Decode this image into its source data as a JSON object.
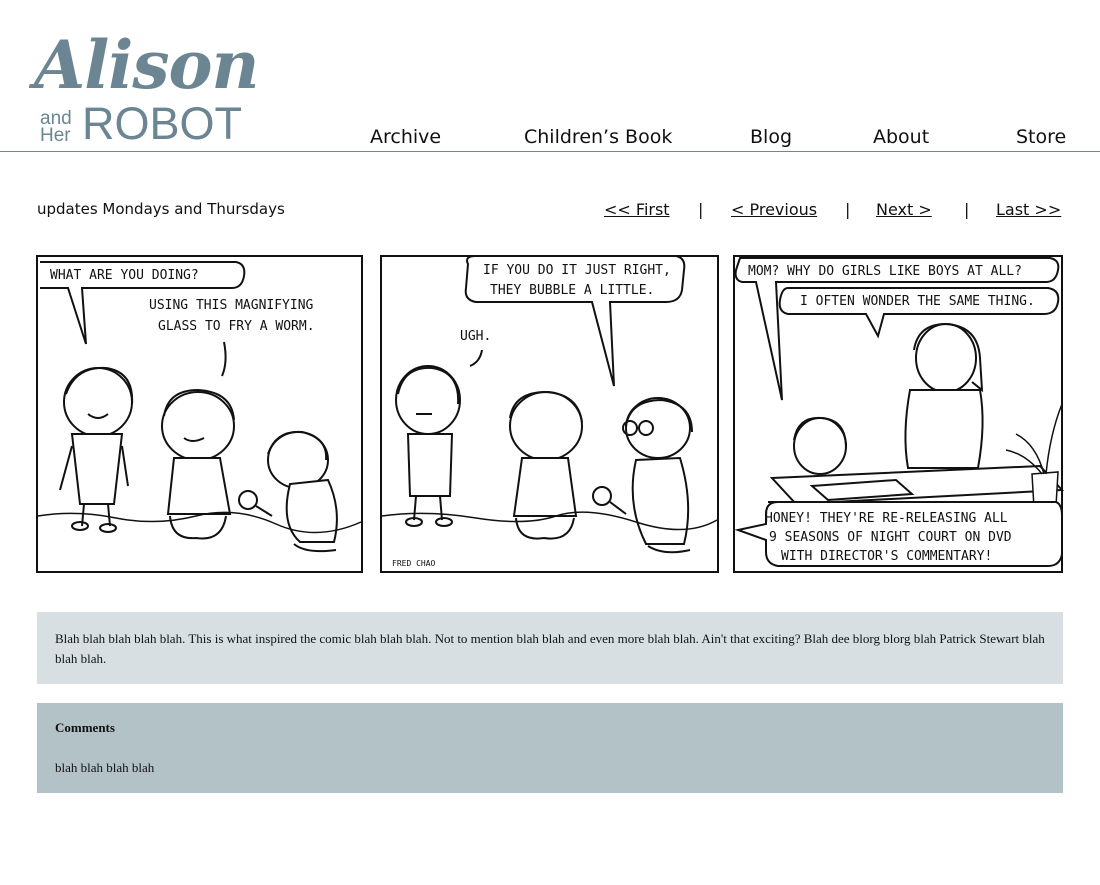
{
  "brand": {
    "script": "Alison",
    "and_her": [
      "and",
      "Her"
    ],
    "robot": "ROBOT"
  },
  "nav": {
    "items": [
      {
        "label": "Archive"
      },
      {
        "label": "Children’s Book"
      },
      {
        "label": "Blog"
      },
      {
        "label": "About"
      },
      {
        "label": "Store"
      }
    ]
  },
  "tagline": "updates Mondays and Thursdays",
  "pager": {
    "first": "<<  First",
    "previous": "<  Previous",
    "next": "Next  >",
    "last": "Last  >>",
    "separator": "|"
  },
  "comic": {
    "panel1": {
      "balloon1": "WHAT ARE YOU DOING?",
      "balloon2": [
        "USING THIS MAGNIFYING",
        "GLASS TO FRY A WORM."
      ]
    },
    "panel2": {
      "balloon1": [
        "IF YOU DO IT JUST RIGHT,",
        "THEY BUBBLE A LITTLE."
      ],
      "balloon2": "UGH.",
      "signature": "FRED CHAO"
    },
    "panel3": {
      "balloon1": "MOM? WHY DO GIRLS LIKE BOYS AT ALL?",
      "balloon2": "I OFTEN WONDER THE SAME THING.",
      "balloon3": [
        "HONEY! THEY'RE RE-RELEASING ALL",
        "9 SEASONS OF NIGHT COURT ON DVD",
        "WITH DIRECTOR'S COMMENTARY!"
      ]
    }
  },
  "blurb": "Blah blah blah blah blah. This is what inspired the comic blah blah blah. Not to mention blah blah and even more blah blah. Ain't that exciting? Blah dee blorg blorg blah Patrick Stewart blah blah blah.",
  "comments": {
    "heading": "Comments",
    "body": "blah blah blah blah"
  },
  "colors": {
    "brand": "#6b8692",
    "blurb_bg": "#d8dfe2",
    "comments_bg": "#b2c2c7",
    "rule": "#6e8790"
  }
}
